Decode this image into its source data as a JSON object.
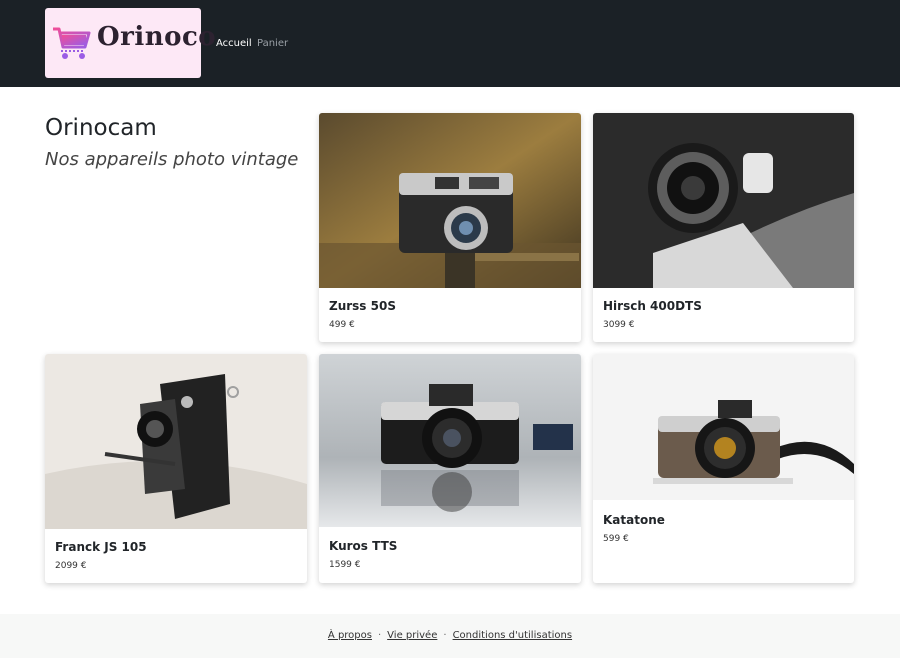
{
  "brand": {
    "name": "Orinoco",
    "logo_icon": "shopping-cart-icon",
    "accent": "#e94fa8"
  },
  "nav": {
    "home_label": "Accueil",
    "cart_label": "Panier"
  },
  "hero": {
    "title": "Orinocam",
    "subtitle": "Nos appareils photo vintage"
  },
  "products": [
    {
      "name": "Zurss 50S",
      "price": "499 €"
    },
    {
      "name": "Hirsch 400DTS",
      "price": "3099 €"
    },
    {
      "name": "Franck JS 105",
      "price": "2099 €"
    },
    {
      "name": "Kuros TTS",
      "price": "1599 €"
    },
    {
      "name": "Katatone",
      "price": "599 €"
    }
  ],
  "footer": {
    "about": "À propos",
    "privacy": "Vie privée",
    "terms": "Conditions d'utilisations",
    "separator": "·"
  }
}
